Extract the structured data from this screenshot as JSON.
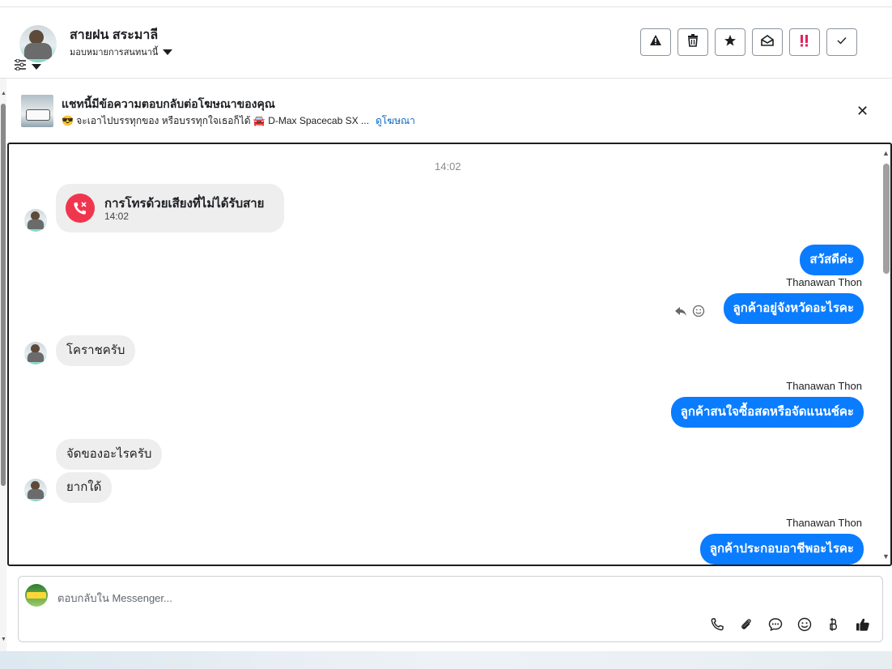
{
  "header": {
    "contact_name": "สายฝน สระมาลี",
    "assign_label": "มอบหมายการสนทนานี้",
    "actions": [
      {
        "icon": "warning-icon"
      },
      {
        "icon": "trash-icon"
      },
      {
        "icon": "star-icon"
      },
      {
        "icon": "mark-unread-icon"
      },
      {
        "icon": "spam-alert-icon"
      },
      {
        "icon": "check-icon"
      }
    ]
  },
  "banner": {
    "title": "แชทนี้มีข้อความตอบกลับต่อโฆษณาของคุณ",
    "subtitle": "😎 จะเอาไปบรรทุกของ หรือบรรทุกใจเธอก็ได้ 🚘 D-Max Spacecab SX ...",
    "link": "ดูโฆษณา"
  },
  "chat": {
    "timestamp": "14:02",
    "missed_call": {
      "title": "การโทรด้วยเสียงที่ไม่ได้รับสาย",
      "time": "14:02"
    },
    "messages": [
      {
        "text": "สวัสดีค่ะ"
      },
      {
        "sender": "Thanawan Thon",
        "text": "ลูกค้าอยู่จังหวัดอะไรคะ"
      },
      {
        "text": "โคราชครับ"
      },
      {
        "sender": "Thanawan Thon",
        "text": "ลูกค้าสนใจซื้อสดหรือจัดแนนช์คะ"
      },
      {
        "text": "จัดของอะไรครับ"
      },
      {
        "text": "ยากใด้"
      },
      {
        "sender": "Thanawan Thon",
        "text": "ลูกค้าประกอบอาชีพอะไรคะ"
      }
    ]
  },
  "composer": {
    "placeholder": "ตอบกลับใน Messenger...",
    "icons": [
      "phone-icon",
      "attach-icon",
      "saved-reply-icon",
      "emoji-icon",
      "baht-icon",
      "thumbs-up-icon"
    ]
  },
  "colors": {
    "accent": "#0a7cff",
    "missed_call": "#f0364e",
    "incoming_bubble": "#eeeeee"
  }
}
